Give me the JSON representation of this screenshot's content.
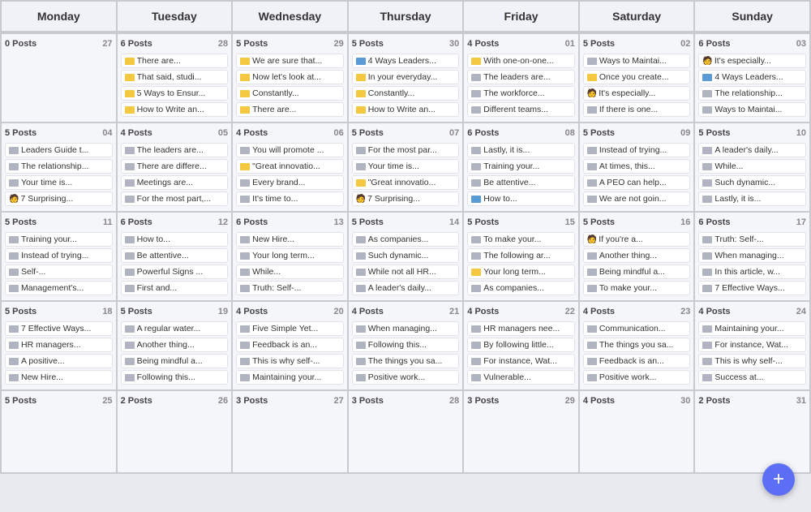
{
  "headers": [
    "Monday",
    "Tuesday",
    "Wednesday",
    "Thursday",
    "Friday",
    "Saturday",
    "Sunday"
  ],
  "weeks": [
    {
      "days": [
        {
          "name": "monday",
          "postCount": "0 Posts",
          "dayNum": "27",
          "posts": []
        },
        {
          "name": "tuesday",
          "postCount": "6 Posts",
          "dayNum": "28",
          "posts": [
            {
              "icon": "yellow",
              "text": "There are..."
            },
            {
              "icon": "yellow",
              "text": "That said, studi..."
            },
            {
              "icon": "yellow",
              "text": "5 Ways to Ensur..."
            },
            {
              "icon": "yellow",
              "text": "How to Write an..."
            }
          ]
        },
        {
          "name": "wednesday",
          "postCount": "5 Posts",
          "dayNum": "29",
          "posts": [
            {
              "icon": "yellow",
              "text": "We are sure that..."
            },
            {
              "icon": "yellow",
              "text": "Now let's look at..."
            },
            {
              "icon": "yellow",
              "text": "Constantly..."
            },
            {
              "icon": "yellow",
              "text": "There are..."
            }
          ]
        },
        {
          "name": "thursday",
          "postCount": "5 Posts",
          "dayNum": "30",
          "posts": [
            {
              "icon": "blue",
              "text": "4 Ways Leaders..."
            },
            {
              "icon": "yellow",
              "text": "In your everyday..."
            },
            {
              "icon": "yellow",
              "text": "Constantly..."
            },
            {
              "icon": "yellow",
              "text": "How to Write an..."
            }
          ]
        },
        {
          "name": "friday",
          "postCount": "4 Posts",
          "dayNum": "01",
          "posts": [
            {
              "icon": "yellow",
              "text": "With one-on-one..."
            },
            {
              "icon": "gray",
              "text": "The leaders are..."
            },
            {
              "icon": "gray",
              "text": "The workforce..."
            },
            {
              "icon": "gray",
              "text": "Different teams..."
            }
          ]
        },
        {
          "name": "saturday",
          "postCount": "5 Posts",
          "dayNum": "02",
          "posts": [
            {
              "icon": "gray",
              "text": "Ways to Maintai..."
            },
            {
              "icon": "yellow",
              "text": "Once you create..."
            },
            {
              "icon": "person",
              "text": "It's especially..."
            },
            {
              "icon": "gray",
              "text": "If there is one..."
            }
          ]
        },
        {
          "name": "sunday",
          "postCount": "6 Posts",
          "dayNum": "03",
          "posts": [
            {
              "icon": "person",
              "text": "It's especially..."
            },
            {
              "icon": "blue",
              "text": "4 Ways Leaders..."
            },
            {
              "icon": "gray",
              "text": "The relationship..."
            },
            {
              "icon": "gray",
              "text": "Ways to Maintai..."
            }
          ]
        }
      ]
    },
    {
      "days": [
        {
          "name": "monday",
          "postCount": "5 Posts",
          "dayNum": "04",
          "posts": [
            {
              "icon": "gray",
              "text": "Leaders Guide t..."
            },
            {
              "icon": "gray",
              "text": "The relationship..."
            },
            {
              "icon": "gray",
              "text": "Your time is..."
            },
            {
              "icon": "person",
              "text": "7 Surprising..."
            }
          ]
        },
        {
          "name": "tuesday",
          "postCount": "4 Posts",
          "dayNum": "05",
          "posts": [
            {
              "icon": "gray",
              "text": "The leaders are..."
            },
            {
              "icon": "gray",
              "text": "There are differe..."
            },
            {
              "icon": "gray",
              "text": "Meetings are..."
            },
            {
              "icon": "gray",
              "text": "For the most part,..."
            }
          ]
        },
        {
          "name": "wednesday",
          "postCount": "4 Posts",
          "dayNum": "06",
          "posts": [
            {
              "icon": "gray",
              "text": "You will promote ..."
            },
            {
              "icon": "yellow",
              "text": "\"Great innovatio..."
            },
            {
              "icon": "gray",
              "text": "Every brand..."
            },
            {
              "icon": "gray",
              "text": "It's time to..."
            }
          ]
        },
        {
          "name": "thursday",
          "postCount": "5 Posts",
          "dayNum": "07",
          "posts": [
            {
              "icon": "gray",
              "text": "For the most par..."
            },
            {
              "icon": "gray",
              "text": "Your time is..."
            },
            {
              "icon": "yellow",
              "text": "\"Great innovatio..."
            },
            {
              "icon": "person",
              "text": "7 Surprising..."
            }
          ]
        },
        {
          "name": "friday",
          "postCount": "6 Posts",
          "dayNum": "08",
          "posts": [
            {
              "icon": "gray",
              "text": "Lastly, it is..."
            },
            {
              "icon": "gray",
              "text": "Training your..."
            },
            {
              "icon": "gray",
              "text": "Be attentive..."
            },
            {
              "icon": "blue",
              "text": "How to..."
            }
          ]
        },
        {
          "name": "saturday",
          "postCount": "5 Posts",
          "dayNum": "09",
          "posts": [
            {
              "icon": "gray",
              "text": "Instead of trying..."
            },
            {
              "icon": "gray",
              "text": "At times, this..."
            },
            {
              "icon": "gray",
              "text": "A PEO can help..."
            },
            {
              "icon": "gray",
              "text": "We are not goin..."
            }
          ]
        },
        {
          "name": "sunday",
          "postCount": "5 Posts",
          "dayNum": "10",
          "posts": [
            {
              "icon": "gray",
              "text": "A leader's daily..."
            },
            {
              "icon": "gray",
              "text": "While..."
            },
            {
              "icon": "gray",
              "text": "Such dynamic..."
            },
            {
              "icon": "gray",
              "text": "Lastly, it is..."
            }
          ]
        }
      ]
    },
    {
      "days": [
        {
          "name": "monday",
          "postCount": "5 Posts",
          "dayNum": "11",
          "posts": [
            {
              "icon": "gray",
              "text": "Training your..."
            },
            {
              "icon": "gray",
              "text": "Instead of trying..."
            },
            {
              "icon": "gray",
              "text": "Self-..."
            },
            {
              "icon": "gray",
              "text": "Management's..."
            }
          ]
        },
        {
          "name": "tuesday",
          "postCount": "6 Posts",
          "dayNum": "12",
          "posts": [
            {
              "icon": "gray",
              "text": "How to..."
            },
            {
              "icon": "gray",
              "text": "Be attentive..."
            },
            {
              "icon": "gray",
              "text": "Powerful Signs ..."
            },
            {
              "icon": "gray",
              "text": "First and..."
            }
          ]
        },
        {
          "name": "wednesday",
          "postCount": "6 Posts",
          "dayNum": "13",
          "posts": [
            {
              "icon": "gray",
              "text": "New Hire..."
            },
            {
              "icon": "gray",
              "text": "Your long term..."
            },
            {
              "icon": "gray",
              "text": "While..."
            },
            {
              "icon": "gray",
              "text": "Truth: Self-..."
            }
          ]
        },
        {
          "name": "thursday",
          "postCount": "5 Posts",
          "dayNum": "14",
          "posts": [
            {
              "icon": "gray",
              "text": "As companies..."
            },
            {
              "icon": "gray",
              "text": "Such dynamic..."
            },
            {
              "icon": "gray",
              "text": "While not all HR..."
            },
            {
              "icon": "gray",
              "text": "A leader's daily..."
            }
          ]
        },
        {
          "name": "friday",
          "postCount": "5 Posts",
          "dayNum": "15",
          "posts": [
            {
              "icon": "gray",
              "text": "To make your..."
            },
            {
              "icon": "gray",
              "text": "The following ar..."
            },
            {
              "icon": "yellow",
              "text": "Your long term..."
            },
            {
              "icon": "gray",
              "text": "As companies..."
            }
          ]
        },
        {
          "name": "saturday",
          "postCount": "5 Posts",
          "dayNum": "16",
          "posts": [
            {
              "icon": "person",
              "text": "If you're a..."
            },
            {
              "icon": "gray",
              "text": "Another thing..."
            },
            {
              "icon": "gray",
              "text": "Being mindful a..."
            },
            {
              "icon": "gray",
              "text": "To make your..."
            }
          ]
        },
        {
          "name": "sunday",
          "postCount": "6 Posts",
          "dayNum": "17",
          "posts": [
            {
              "icon": "gray",
              "text": "Truth: Self-..."
            },
            {
              "icon": "gray",
              "text": "When managing..."
            },
            {
              "icon": "gray",
              "text": "In this article, w..."
            },
            {
              "icon": "gray",
              "text": "7 Effective Ways..."
            }
          ]
        }
      ]
    },
    {
      "days": [
        {
          "name": "monday",
          "postCount": "5 Posts",
          "dayNum": "18",
          "posts": [
            {
              "icon": "gray",
              "text": "7 Effective Ways..."
            },
            {
              "icon": "gray",
              "text": "HR managers..."
            },
            {
              "icon": "gray",
              "text": "A positive..."
            },
            {
              "icon": "gray",
              "text": "New Hire..."
            }
          ]
        },
        {
          "name": "tuesday",
          "postCount": "5 Posts",
          "dayNum": "19",
          "posts": [
            {
              "icon": "gray",
              "text": "A regular water..."
            },
            {
              "icon": "gray",
              "text": "Another thing..."
            },
            {
              "icon": "gray",
              "text": "Being mindful a..."
            },
            {
              "icon": "gray",
              "text": "Following this..."
            }
          ]
        },
        {
          "name": "wednesday",
          "postCount": "4 Posts",
          "dayNum": "20",
          "posts": [
            {
              "icon": "gray",
              "text": "Five Simple Yet..."
            },
            {
              "icon": "gray",
              "text": "Feedback is an..."
            },
            {
              "icon": "gray",
              "text": "This is why self-..."
            },
            {
              "icon": "gray",
              "text": "Maintaining your..."
            }
          ]
        },
        {
          "name": "thursday",
          "postCount": "4 Posts",
          "dayNum": "21",
          "posts": [
            {
              "icon": "gray",
              "text": "When managing..."
            },
            {
              "icon": "gray",
              "text": "Following this..."
            },
            {
              "icon": "gray",
              "text": "The things you sa..."
            },
            {
              "icon": "gray",
              "text": "Positive work..."
            }
          ]
        },
        {
          "name": "friday",
          "postCount": "4 Posts",
          "dayNum": "22",
          "posts": [
            {
              "icon": "gray",
              "text": "HR managers nee..."
            },
            {
              "icon": "gray",
              "text": "By following little..."
            },
            {
              "icon": "gray",
              "text": "For instance, Wat..."
            },
            {
              "icon": "gray",
              "text": "Vulnerable..."
            }
          ]
        },
        {
          "name": "saturday",
          "postCount": "4 Posts",
          "dayNum": "23",
          "posts": [
            {
              "icon": "gray",
              "text": "Communication..."
            },
            {
              "icon": "gray",
              "text": "The things you sa..."
            },
            {
              "icon": "gray",
              "text": "Feedback is an..."
            },
            {
              "icon": "gray",
              "text": "Positive work..."
            }
          ]
        },
        {
          "name": "sunday",
          "postCount": "4 Posts",
          "dayNum": "24",
          "posts": [
            {
              "icon": "gray",
              "text": "Maintaining your..."
            },
            {
              "icon": "gray",
              "text": "For instance, Wat..."
            },
            {
              "icon": "gray",
              "text": "This is why self-..."
            },
            {
              "icon": "gray",
              "text": "Success at..."
            }
          ]
        }
      ]
    },
    {
      "days": [
        {
          "name": "monday",
          "postCount": "5 Posts",
          "dayNum": "25",
          "posts": []
        },
        {
          "name": "tuesday",
          "postCount": "2 Posts",
          "dayNum": "26",
          "posts": []
        },
        {
          "name": "wednesday",
          "postCount": "3 Posts",
          "dayNum": "27",
          "posts": []
        },
        {
          "name": "thursday",
          "postCount": "3 Posts",
          "dayNum": "28",
          "posts": []
        },
        {
          "name": "friday",
          "postCount": "3 Posts",
          "dayNum": "29",
          "posts": []
        },
        {
          "name": "saturday",
          "postCount": "4 Posts",
          "dayNum": "30",
          "posts": []
        },
        {
          "name": "sunday",
          "postCount": "2 Posts",
          "dayNum": "31",
          "posts": []
        }
      ]
    }
  ],
  "fab": "+"
}
